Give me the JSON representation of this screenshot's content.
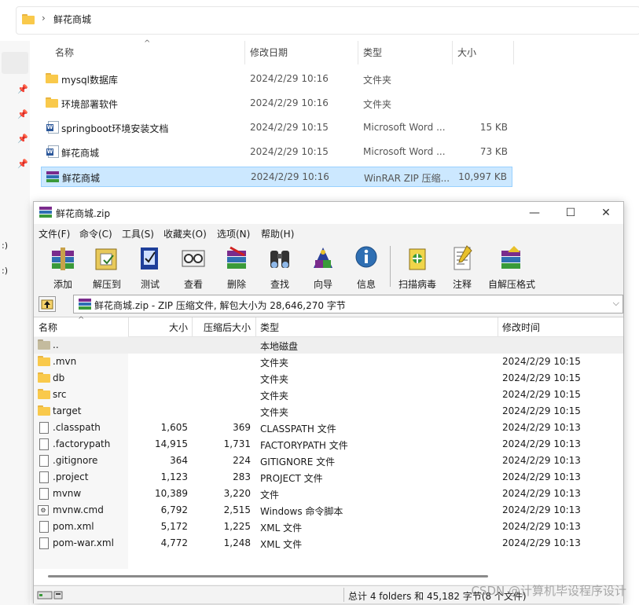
{
  "explorer": {
    "breadcrumb": "鲜花商城",
    "columns": {
      "name": "名称",
      "date": "修改日期",
      "type": "类型",
      "size": "大小"
    },
    "sidebar_fragments": [
      ":)",
      ":)"
    ],
    "files": [
      {
        "icon": "folder-icon",
        "name": "mysql数据库",
        "date": "2024/2/29 10:16",
        "type": "文件夹",
        "size": ""
      },
      {
        "icon": "folder-icon",
        "name": "环境部署软件",
        "date": "2024/2/29 10:16",
        "type": "文件夹",
        "size": ""
      },
      {
        "icon": "word-doc-icon",
        "name": "springboot环境安装文档",
        "date": "2024/2/29 10:15",
        "type": "Microsoft Word ...",
        "size": "15 KB"
      },
      {
        "icon": "word-doc-icon",
        "name": "鲜花商城",
        "date": "2024/2/29 10:15",
        "type": "Microsoft Word ...",
        "size": "73 KB"
      },
      {
        "icon": "winrar-archive-icon",
        "name": "鲜花商城",
        "date": "2024/2/29 10:16",
        "type": "WinRAR ZIP 压缩...",
        "size": "10,997 KB",
        "selected": true
      }
    ]
  },
  "winrar": {
    "title": "鲜花商城.zip",
    "menu": [
      "文件(F)",
      "命令(C)",
      "工具(S)",
      "收藏夹(O)",
      "选项(N)",
      "帮助(H)"
    ],
    "toolbar": [
      {
        "label": "添加",
        "icon": "add-archive-icon"
      },
      {
        "label": "解压到",
        "icon": "extract-to-icon"
      },
      {
        "label": "测试",
        "icon": "test-icon"
      },
      {
        "label": "查看",
        "icon": "view-icon"
      },
      {
        "label": "删除",
        "icon": "delete-icon"
      },
      {
        "label": "查找",
        "icon": "find-icon"
      },
      {
        "label": "向导",
        "icon": "wizard-icon"
      },
      {
        "label": "信息",
        "icon": "info-icon"
      },
      {
        "label": "扫描病毒",
        "icon": "virus-scan-icon"
      },
      {
        "label": "注释",
        "icon": "comment-icon"
      },
      {
        "label": "自解压格式",
        "icon": "sfx-icon"
      }
    ],
    "path": "鲜花商城.zip - ZIP 压缩文件, 解包大小为 28,646,270 字节",
    "columns": {
      "name": "名称",
      "size": "大小",
      "packed": "压缩后大小",
      "type": "类型",
      "modified": "修改时间"
    },
    "rows": [
      {
        "icon": "folder-up-icon",
        "name": "..",
        "size": "",
        "packed": "",
        "type": "本地磁盘",
        "modified": ""
      },
      {
        "icon": "folder-icon",
        "name": ".mvn",
        "size": "",
        "packed": "",
        "type": "文件夹",
        "modified": "2024/2/29 10:15"
      },
      {
        "icon": "folder-icon",
        "name": "db",
        "size": "",
        "packed": "",
        "type": "文件夹",
        "modified": "2024/2/29 10:15"
      },
      {
        "icon": "folder-icon",
        "name": "src",
        "size": "",
        "packed": "",
        "type": "文件夹",
        "modified": "2024/2/29 10:15"
      },
      {
        "icon": "folder-icon",
        "name": "target",
        "size": "",
        "packed": "",
        "type": "文件夹",
        "modified": "2024/2/29 10:15"
      },
      {
        "icon": "file-icon",
        "name": ".classpath",
        "size": "1,605",
        "packed": "369",
        "type": "CLASSPATH 文件",
        "modified": "2024/2/29 10:13"
      },
      {
        "icon": "file-icon",
        "name": ".factorypath",
        "size": "14,915",
        "packed": "1,731",
        "type": "FACTORYPATH 文件",
        "modified": "2024/2/29 10:13"
      },
      {
        "icon": "file-icon",
        "name": ".gitignore",
        "size": "364",
        "packed": "224",
        "type": "GITIGNORE 文件",
        "modified": "2024/2/29 10:13"
      },
      {
        "icon": "file-icon",
        "name": ".project",
        "size": "1,123",
        "packed": "283",
        "type": "PROJECT 文件",
        "modified": "2024/2/29 10:13"
      },
      {
        "icon": "file-icon",
        "name": "mvnw",
        "size": "10,389",
        "packed": "3,220",
        "type": "文件",
        "modified": "2024/2/29 10:13"
      },
      {
        "icon": "cmd-script-icon",
        "name": "mvnw.cmd",
        "size": "6,792",
        "packed": "2,515",
        "type": "Windows 命令脚本",
        "modified": "2024/2/29 10:13"
      },
      {
        "icon": "file-icon",
        "name": "pom.xml",
        "size": "5,172",
        "packed": "1,225",
        "type": "XML 文件",
        "modified": "2024/2/29 10:13"
      },
      {
        "icon": "file-icon",
        "name": "pom-war.xml",
        "size": "4,772",
        "packed": "1,248",
        "type": "XML 文件",
        "modified": "2024/2/29 10:13"
      }
    ],
    "status": "总计 4 folders 和 45,182 字节(8 个文件)"
  },
  "watermark": "CSDN @计算机毕设程序设计"
}
